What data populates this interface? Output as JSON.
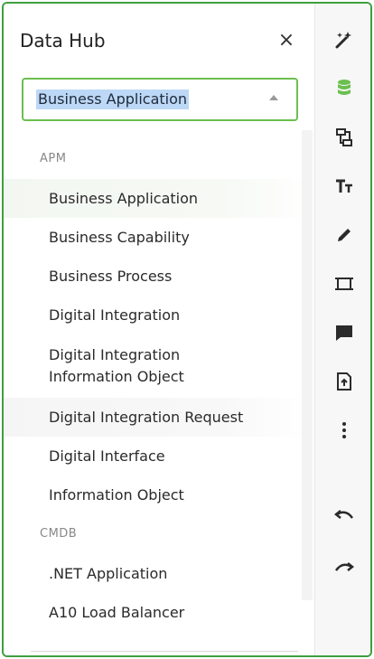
{
  "panel": {
    "title": "Data Hub",
    "close_glyph": "×",
    "select": {
      "value": "Business Application"
    }
  },
  "groups": [
    {
      "label": "APM",
      "items": [
        "Business Application",
        "Business Capability",
        "Business Process",
        "Digital Integration",
        "Digital Integration Information Object",
        "Digital Integration Request",
        "Digital Interface",
        "Information Object"
      ]
    },
    {
      "label": "CMDB",
      "items": [
        ".NET Application",
        "A10 Load Balancer"
      ]
    }
  ],
  "toolbar": {
    "tools": [
      "magic-wand-icon",
      "database-icon",
      "hierarchy-icon",
      "text-tool-icon",
      "pencil-icon",
      "frame-icon",
      "comment-icon",
      "upload-file-icon",
      "more-options-icon",
      "undo-icon",
      "redo-icon"
    ],
    "accent": "#6bbf4f"
  },
  "colors": {
    "border": "#3f9f3f",
    "select_border": "#6bbf4f",
    "selection_bg": "#bcd8f6"
  }
}
